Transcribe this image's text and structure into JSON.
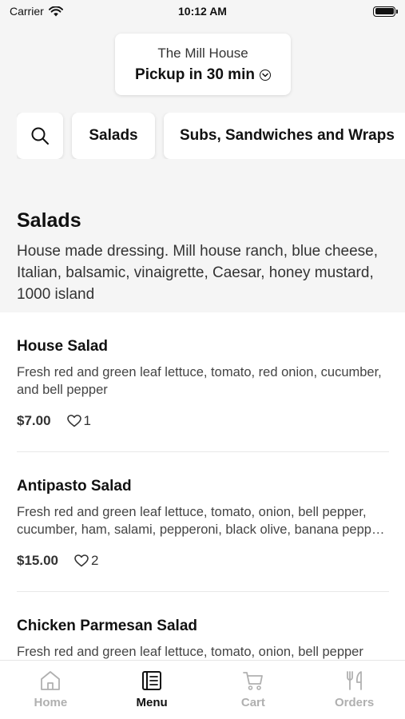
{
  "status_bar": {
    "carrier": "Carrier",
    "time": "10:12 AM"
  },
  "store": {
    "name": "The Mill House",
    "pickup": "Pickup in 30 min"
  },
  "categories": [
    {
      "label": "Salads"
    },
    {
      "label": "Subs, Sandwiches and Wraps"
    }
  ],
  "section": {
    "title": "Salads",
    "description": "House made dressing. Mill house ranch, blue cheese, Italian, balsamic, vinaigrette, Caesar, honey mustard, 1000 island"
  },
  "items": [
    {
      "title": "House Salad",
      "description": "Fresh red and green leaf lettuce, tomato, red onion, cucumber, and bell pepper",
      "price": "$7.00",
      "likes": "1"
    },
    {
      "title": "Antipasto Salad",
      "description": "Fresh red and green leaf lettuce, tomato, onion, bell pepper, cucumber, ham, salami, pepperoni, black olive, banana pepper and mozzarella",
      "price": "$15.00",
      "likes": "2"
    },
    {
      "title": "Chicken Parmesan Salad",
      "description": "Fresh red and green leaf lettuce, tomato, onion, bell pepper",
      "price": "",
      "likes": ""
    }
  ],
  "tab_bar": {
    "tabs": [
      {
        "label": "Home",
        "icon": "home-icon",
        "active": false
      },
      {
        "label": "Menu",
        "icon": "menu-book-icon",
        "active": true
      },
      {
        "label": "Cart",
        "icon": "cart-icon",
        "active": false
      },
      {
        "label": "Orders",
        "icon": "utensils-icon",
        "active": false
      }
    ]
  },
  "colors": {
    "background": "#f5f5f5",
    "card": "#ffffff",
    "text": "#111111",
    "inactive_tab": "#b0b0b0"
  }
}
